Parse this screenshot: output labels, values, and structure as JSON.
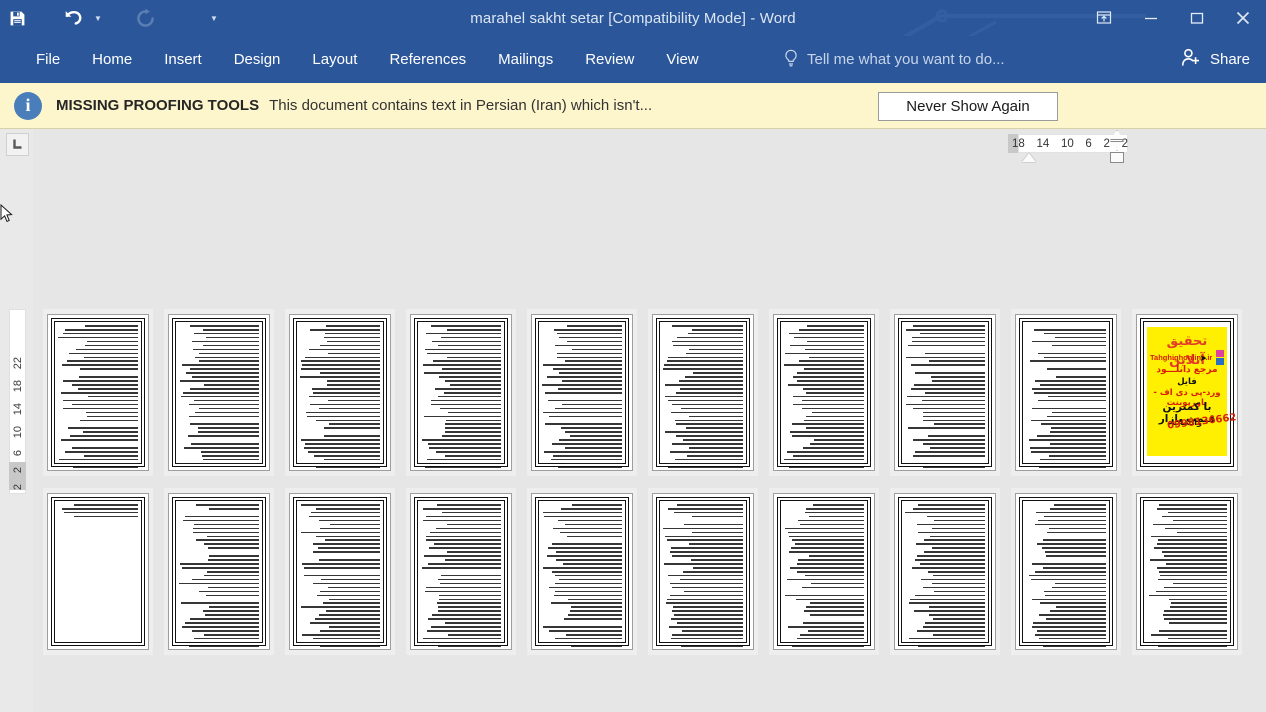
{
  "window": {
    "title": "marahel sakht setar [Compatibility Mode] - Word",
    "quick_access": [
      {
        "name": "save",
        "glyph": "💾",
        "label": "Save"
      },
      {
        "name": "undo",
        "glyph": "↶",
        "label": "Undo"
      },
      {
        "name": "redo",
        "glyph": "↻",
        "label": "Redo"
      },
      {
        "name": "customize",
        "glyph": "▾",
        "label": "Customize Quick Access Toolbar"
      }
    ],
    "controls": {
      "ribbon_display": "⤓",
      "minimize": "—",
      "restore": "❐",
      "close": "✕"
    },
    "accent_color": "#2b579a"
  },
  "ribbon": {
    "tabs": [
      {
        "label": "File"
      },
      {
        "label": "Home"
      },
      {
        "label": "Insert"
      },
      {
        "label": "Design"
      },
      {
        "label": "Layout"
      },
      {
        "label": "References"
      },
      {
        "label": "Mailings"
      },
      {
        "label": "Review"
      },
      {
        "label": "View"
      }
    ],
    "tell_me": "Tell me what you want to do...",
    "share": "Share"
  },
  "message_bar": {
    "title": "MISSING PROOFING TOOLS",
    "text": "This document contains text in Persian (Iran) which isn't...",
    "button": "Never Show Again",
    "background": "#fdf6cd"
  },
  "rulers": {
    "horizontal": [
      "18",
      "14",
      "10",
      "6",
      "2",
      "2"
    ],
    "vertical": [
      "2",
      "2",
      "6",
      "10",
      "14",
      "18",
      "22"
    ],
    "tab_selector": "L"
  },
  "pages": {
    "row1": [
      {
        "kind": "text",
        "density": "full"
      },
      {
        "kind": "text",
        "density": "mixed"
      },
      {
        "kind": "text",
        "density": "full"
      },
      {
        "kind": "text",
        "density": "mixed"
      },
      {
        "kind": "text",
        "density": "full"
      },
      {
        "kind": "text",
        "density": "mixed"
      },
      {
        "kind": "text",
        "density": "full"
      },
      {
        "kind": "text",
        "density": "full"
      },
      {
        "kind": "text",
        "density": "mixed"
      },
      {
        "kind": "ad"
      }
    ],
    "row2": [
      {
        "kind": "text",
        "density": "sparse"
      },
      {
        "kind": "text",
        "density": "full"
      },
      {
        "kind": "text",
        "density": "mixed"
      },
      {
        "kind": "text",
        "density": "mixed"
      },
      {
        "kind": "text",
        "density": "full"
      },
      {
        "kind": "text",
        "density": "full"
      },
      {
        "kind": "text",
        "density": "mixed"
      },
      {
        "kind": "text",
        "density": "full"
      },
      {
        "kind": "text",
        "density": "mixed"
      },
      {
        "kind": "text",
        "density": "mixed"
      }
    ]
  },
  "advertisement": {
    "headline": "تحقیق آنلاین",
    "url": "Tahghighonline.ir",
    "line2": "مرجع دانلـــود",
    "line3": "فایل",
    "line4": "ورد-پی دی اف - پاورپوینت",
    "line5": "با کمترین قیمت بازار",
    "line6": "واتساپ",
    "phone": "09981366624",
    "background": "#ffef00",
    "accent": "#d81e05"
  }
}
